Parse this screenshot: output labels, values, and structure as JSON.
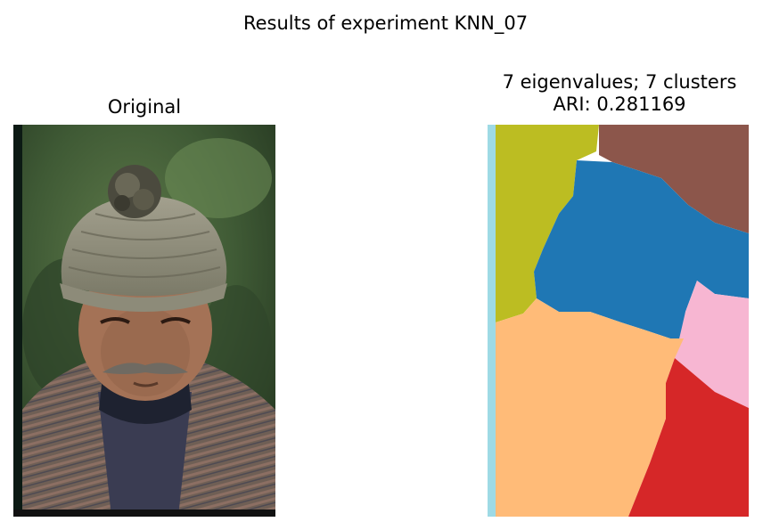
{
  "figure": {
    "suptitle": "Results of experiment KNN_07"
  },
  "panels": [
    {
      "title": "Original",
      "content": "photo of an elderly man wearing a knitted wool cap with a pom-pom, grey moustache, striped robe"
    },
    {
      "title_line1": "7 eigenvalues; 7 clusters",
      "title_line2": "ARI: 0.281169"
    }
  ],
  "chart_data": {
    "type": "heatmap",
    "title": "Results of experiment KNN_07",
    "eigenvalues": 7,
    "clusters": 7,
    "ari": 0.281169,
    "cluster_colors": [
      "#9edae5",
      "#bcbd22",
      "#8c564b",
      "#1f77b4",
      "#f7b6d2",
      "#ffbb78",
      "#d62728"
    ],
    "xlabel": "",
    "ylabel": ""
  }
}
